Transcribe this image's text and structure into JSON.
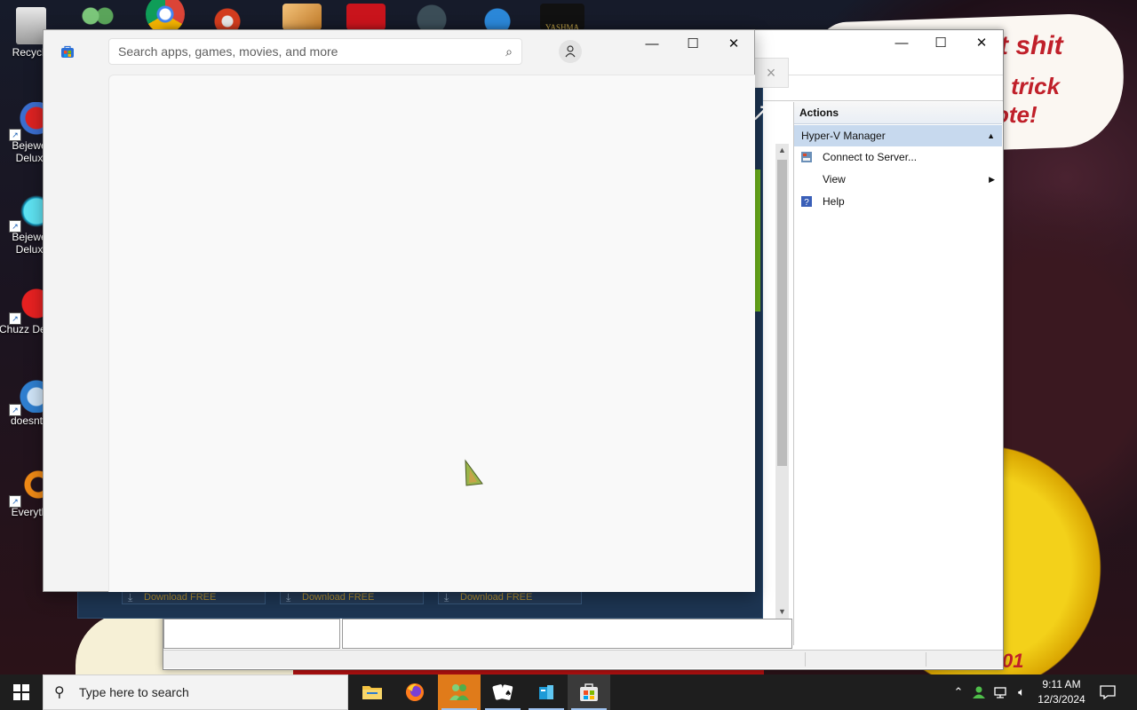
{
  "desktop": {
    "icons": [
      {
        "label": "Recycle"
      },
      {
        "label": "Bejewe Delux"
      },
      {
        "label": "Bejewe Delux"
      },
      {
        "label": "Chuzz Delux"
      },
      {
        "label": "doesnt l"
      },
      {
        "label": "Everyth"
      }
    ],
    "top_icon_text": "YASHMA",
    "wallpaper_text": [
      "t shit",
      "o trick",
      "ote!",
      "01"
    ]
  },
  "store": {
    "search_placeholder": "Search apps, games, movies, and more",
    "minimize": "—",
    "maximize": "☐",
    "close": "✕"
  },
  "hyperv": {
    "minimize": "—",
    "maximize": "☐",
    "close": "✕",
    "sub_close": "×",
    "download_buttons": [
      "Download FREE",
      "Download FREE",
      "Download FREE"
    ],
    "actions": {
      "header": "Actions",
      "section": "Hyper-V Manager",
      "items": [
        {
          "label": "Connect to Server...",
          "icon": "server-icon"
        },
        {
          "label": "View",
          "icon": "none",
          "submenu": true
        },
        {
          "label": "Help",
          "icon": "help-icon"
        }
      ]
    }
  },
  "taskbar": {
    "search_placeholder": "Type here to search",
    "apps": [
      "file-explorer",
      "firefox",
      "people-app",
      "solitaire",
      "app-installer",
      "microsoft-store"
    ],
    "time": "9:11 AM",
    "date": "12/3/2024"
  }
}
